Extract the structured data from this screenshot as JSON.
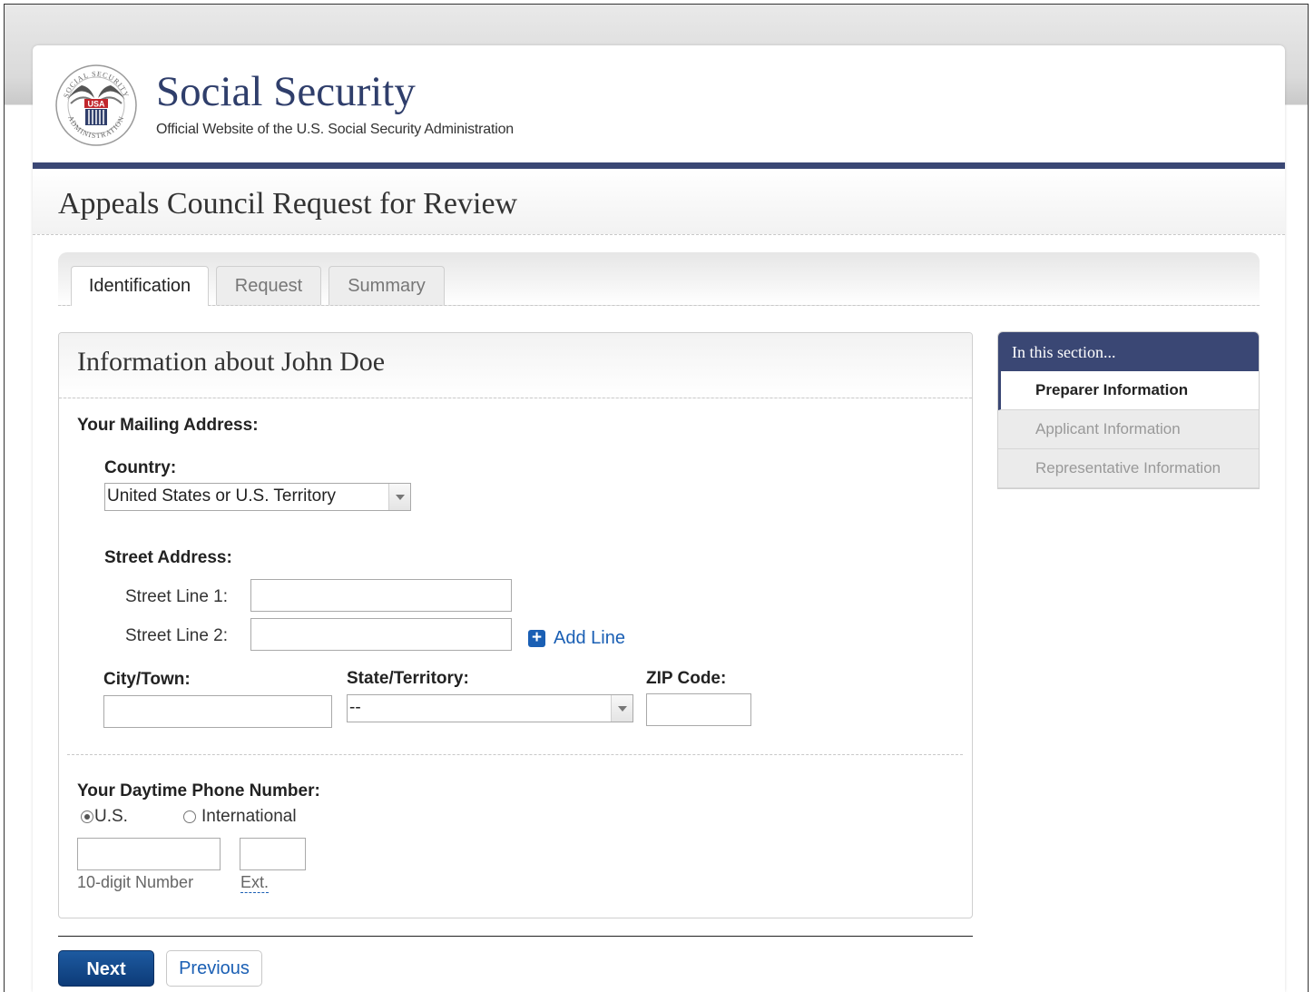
{
  "header": {
    "brand_title": "Social Security",
    "brand_subtitle": "Official Website of the U.S. Social Security Administration",
    "seal_icon": "ssa-seal-icon"
  },
  "page": {
    "title": "Appeals Council Request for Review"
  },
  "tabs": [
    {
      "label": "Identification",
      "active": true
    },
    {
      "label": "Request",
      "active": false
    },
    {
      "label": "Summary",
      "active": false
    }
  ],
  "panel": {
    "title": "Information about John Doe",
    "mailing_address": {
      "heading": "Your Mailing Address:",
      "country_label": "Country:",
      "country_value": "United States or U.S. Territory",
      "street_heading": "Street Address:",
      "street_line1_label": "Street Line 1:",
      "street_line1_value": "",
      "street_line2_label": "Street Line 2:",
      "street_line2_value": "",
      "add_line_label": "Add Line",
      "city_label": "City/Town:",
      "city_value": "",
      "state_label": "State/Territory:",
      "state_value": "--",
      "zip_label": "ZIP Code:",
      "zip_value": ""
    },
    "phone": {
      "heading": "Your Daytime Phone Number:",
      "option_us": "U.S.",
      "option_international": "International",
      "selected": "U.S.",
      "number_value": "",
      "ext_value": "",
      "number_hint": "10-digit Number",
      "ext_hint": "Ext."
    }
  },
  "buttons": {
    "next": "Next",
    "previous": "Previous"
  },
  "sidebar": {
    "heading": "In this section...",
    "items": [
      {
        "label": "Preparer Information",
        "active": true
      },
      {
        "label": "Applicant Information",
        "active": false
      },
      {
        "label": "Representative Information",
        "active": false
      }
    ]
  },
  "colors": {
    "brand_navy": "#3a4774",
    "link_blue": "#1a5fb4",
    "button_navy": "#0d3b78"
  }
}
